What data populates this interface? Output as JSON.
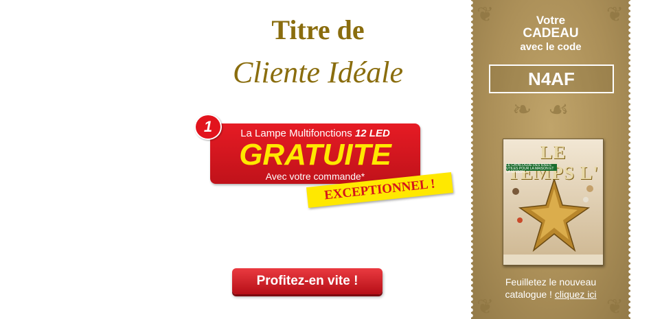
{
  "offer": {
    "title_line1": "Titre de",
    "title_line2": "Cliente Idéale",
    "badge_number": "1",
    "badge_line1_a": "La Lampe Multifonctions ",
    "badge_line1_b": "12 LED",
    "badge_main": "GRATUITE",
    "badge_line3": "Avec votre commande*",
    "sticker": "EXCEPTIONNEL !",
    "cta_label": "Profitez-en vite !"
  },
  "coupon": {
    "line1": "Votre",
    "line2": "CADEAU",
    "line3": "avec le code",
    "code": "N4AF",
    "catalog_title": "LE TEMPS L'",
    "catalog_strip": "LE CATALOGUE DES IDEES UTILES POUR LA MAISON ET LA MAISON",
    "footer_line1": "Feuilletez le nouveau",
    "footer_line2": "catalogue ! ",
    "footer_link": "cliquez ici"
  },
  "colors": {
    "gold_text": "#8a6d0e",
    "red": "#e61b24",
    "yellow": "#ffe800",
    "coupon_bg": "#ab8f58"
  }
}
